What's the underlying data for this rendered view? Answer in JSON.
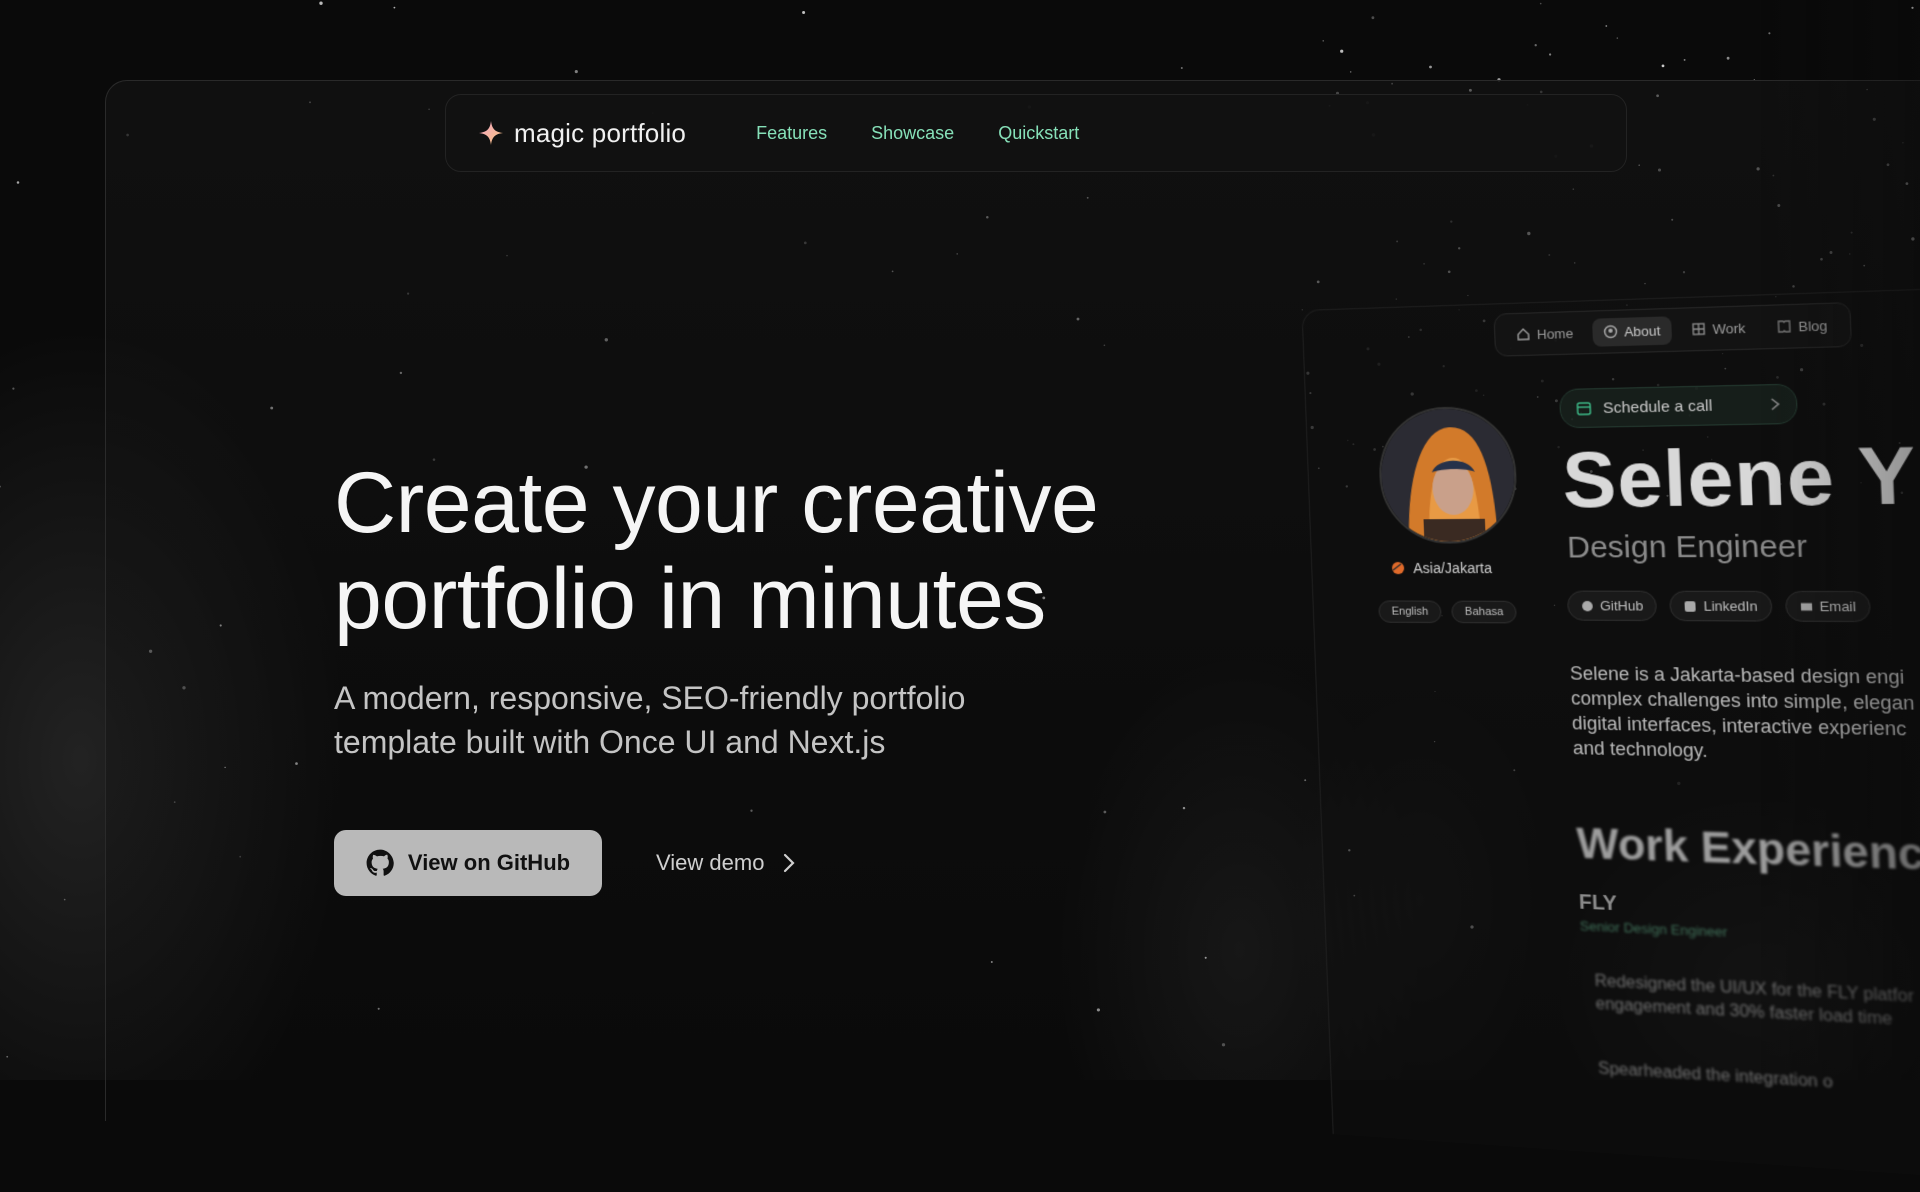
{
  "header": {
    "logo_text": "magic portfolio",
    "nav": [
      {
        "label": "Features"
      },
      {
        "label": "Showcase"
      },
      {
        "label": "Quickstart"
      }
    ]
  },
  "hero": {
    "title_line1": "Create your creative",
    "title_line2": "portfolio in minutes",
    "subtitle_line1": "A modern, responsive, SEO-friendly portfolio",
    "subtitle_line2": "template built with Once UI and Next.js",
    "github_button": "View on GitHub",
    "demo_link": "View demo"
  },
  "preview": {
    "nav": [
      {
        "label": "Home",
        "icon": "home-icon"
      },
      {
        "label": "About",
        "icon": "person-icon"
      },
      {
        "label": "Work",
        "icon": "grid-icon"
      },
      {
        "label": "Blog",
        "icon": "book-icon"
      }
    ],
    "timezone": "Asia/Jakarta",
    "languages": [
      "English",
      "Bahasa"
    ],
    "schedule": "Schedule a call",
    "name": "Selene Y",
    "role": "Design Engineer",
    "links": [
      {
        "label": "GitHub",
        "icon": "github-icon"
      },
      {
        "label": "LinkedIn",
        "icon": "linkedin-icon"
      },
      {
        "label": "Email",
        "icon": "email-icon"
      }
    ],
    "bio_lines": [
      "Selene is a Jakarta-based design engi",
      "complex challenges into simple, elegan",
      "digital interfaces, interactive experienc",
      "and technology."
    ],
    "work_title": "Work Experience",
    "company": "FLY",
    "company_role": "Senior Design Engineer",
    "bullet1_line1": "Redesigned the UI/UX for the FLY platfor",
    "bullet1_line2": "engagement and 30% faster load time",
    "bullet2": "Spearheaded the integration o"
  },
  "colors": {
    "accent": "#86e0b8",
    "background": "#0a0a0a",
    "button_bg": "#b9b9b9"
  }
}
